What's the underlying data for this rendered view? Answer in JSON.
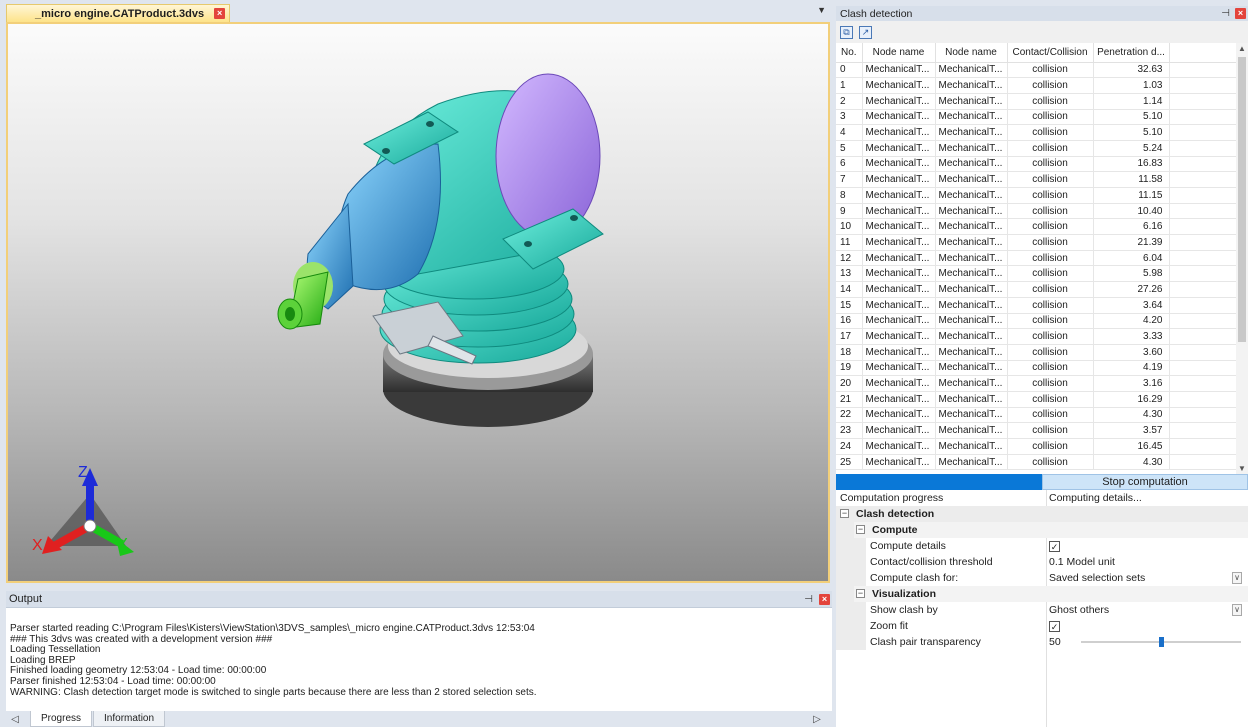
{
  "document_tab": {
    "title": "_micro engine.CATProduct.3dvs"
  },
  "axes_triad": {
    "x_label": "X",
    "y_label": "Y",
    "z_label": "Z"
  },
  "output": {
    "title": "Output",
    "lines": [
      "Parser started reading C:\\Program Files\\Kisters\\ViewStation\\3DVS_samples\\_micro engine.CATProduct.3dvs 12:53:04",
      "### This 3dvs was created with a development version ###",
      "Loading Tessellation",
      "Loading BREP",
      "Finished loading geometry 12:53:04 - Load time: 00:00:00",
      "Parser finished 12:53:04 - Load time: 00:00:00",
      "WARNING: Clash detection target mode is switched to single parts because there are less than 2 stored selection sets."
    ],
    "tabs": [
      "Progress",
      "Information"
    ]
  },
  "clash_panel": {
    "title": "Clash detection",
    "columns": [
      "No.",
      "Node name",
      "Node name",
      "Contact/Collision",
      "Penetration d..."
    ],
    "rows": [
      {
        "no": "0",
        "a": "MechanicalT...",
        "b": "MechanicalT...",
        "type": "collision",
        "pen": "32.63"
      },
      {
        "no": "1",
        "a": "MechanicalT...",
        "b": "MechanicalT...",
        "type": "collision",
        "pen": "1.03"
      },
      {
        "no": "2",
        "a": "MechanicalT...",
        "b": "MechanicalT...",
        "type": "collision",
        "pen": "1.14"
      },
      {
        "no": "3",
        "a": "MechanicalT...",
        "b": "MechanicalT...",
        "type": "collision",
        "pen": "5.10"
      },
      {
        "no": "4",
        "a": "MechanicalT...",
        "b": "MechanicalT...",
        "type": "collision",
        "pen": "5.10"
      },
      {
        "no": "5",
        "a": "MechanicalT...",
        "b": "MechanicalT...",
        "type": "collision",
        "pen": "5.24"
      },
      {
        "no": "6",
        "a": "MechanicalT...",
        "b": "MechanicalT...",
        "type": "collision",
        "pen": "16.83"
      },
      {
        "no": "7",
        "a": "MechanicalT...",
        "b": "MechanicalT...",
        "type": "collision",
        "pen": "11.58"
      },
      {
        "no": "8",
        "a": "MechanicalT...",
        "b": "MechanicalT...",
        "type": "collision",
        "pen": "11.15"
      },
      {
        "no": "9",
        "a": "MechanicalT...",
        "b": "MechanicalT...",
        "type": "collision",
        "pen": "10.40"
      },
      {
        "no": "10",
        "a": "MechanicalT...",
        "b": "MechanicalT...",
        "type": "collision",
        "pen": "6.16"
      },
      {
        "no": "11",
        "a": "MechanicalT...",
        "b": "MechanicalT...",
        "type": "collision",
        "pen": "21.39"
      },
      {
        "no": "12",
        "a": "MechanicalT...",
        "b": "MechanicalT...",
        "type": "collision",
        "pen": "6.04"
      },
      {
        "no": "13",
        "a": "MechanicalT...",
        "b": "MechanicalT...",
        "type": "collision",
        "pen": "5.98"
      },
      {
        "no": "14",
        "a": "MechanicalT...",
        "b": "MechanicalT...",
        "type": "collision",
        "pen": "27.26"
      },
      {
        "no": "15",
        "a": "MechanicalT...",
        "b": "MechanicalT...",
        "type": "collision",
        "pen": "3.64"
      },
      {
        "no": "16",
        "a": "MechanicalT...",
        "b": "MechanicalT...",
        "type": "collision",
        "pen": "4.20"
      },
      {
        "no": "17",
        "a": "MechanicalT...",
        "b": "MechanicalT...",
        "type": "collision",
        "pen": "3.33"
      },
      {
        "no": "18",
        "a": "MechanicalT...",
        "b": "MechanicalT...",
        "type": "collision",
        "pen": "3.60"
      },
      {
        "no": "19",
        "a": "MechanicalT...",
        "b": "MechanicalT...",
        "type": "collision",
        "pen": "4.19"
      },
      {
        "no": "20",
        "a": "MechanicalT...",
        "b": "MechanicalT...",
        "type": "collision",
        "pen": "3.16"
      },
      {
        "no": "21",
        "a": "MechanicalT...",
        "b": "MechanicalT...",
        "type": "collision",
        "pen": "16.29"
      },
      {
        "no": "22",
        "a": "MechanicalT...",
        "b": "MechanicalT...",
        "type": "collision",
        "pen": "4.30"
      },
      {
        "no": "23",
        "a": "MechanicalT...",
        "b": "MechanicalT...",
        "type": "collision",
        "pen": "3.57"
      },
      {
        "no": "24",
        "a": "MechanicalT...",
        "b": "MechanicalT...",
        "type": "collision",
        "pen": "16.45"
      },
      {
        "no": "25",
        "a": "MechanicalT...",
        "b": "MechanicalT...",
        "type": "collision",
        "pen": "4.30"
      }
    ],
    "stop_button": "Stop computation",
    "progress_fraction": 0.5
  },
  "properties": {
    "computation_progress_label": "Computation progress",
    "computation_progress_value": "Computing details...",
    "group_clash": "Clash detection",
    "group_compute": "Compute",
    "compute_details_label": "Compute details",
    "compute_details_checked": true,
    "threshold_label": "Contact/collision threshold",
    "threshold_value": "0.1 Model unit",
    "compute_clash_for_label": "Compute clash for:",
    "compute_clash_for_value": "Saved selection sets",
    "group_visualization": "Visualization",
    "show_clash_by_label": "Show clash by",
    "show_clash_by_value": "Ghost others",
    "zoom_fit_label": "Zoom fit",
    "zoom_fit_checked": true,
    "transparency_label": "Clash pair transparency",
    "transparency_value": "50"
  },
  "colors": {
    "accent": "#0a78d7",
    "tab_active": "#fde38a",
    "model_cyan": "#3dd6c4",
    "model_blue": "#3aa8e6",
    "model_green": "#33dd22",
    "model_purple": "#b48ff0"
  }
}
